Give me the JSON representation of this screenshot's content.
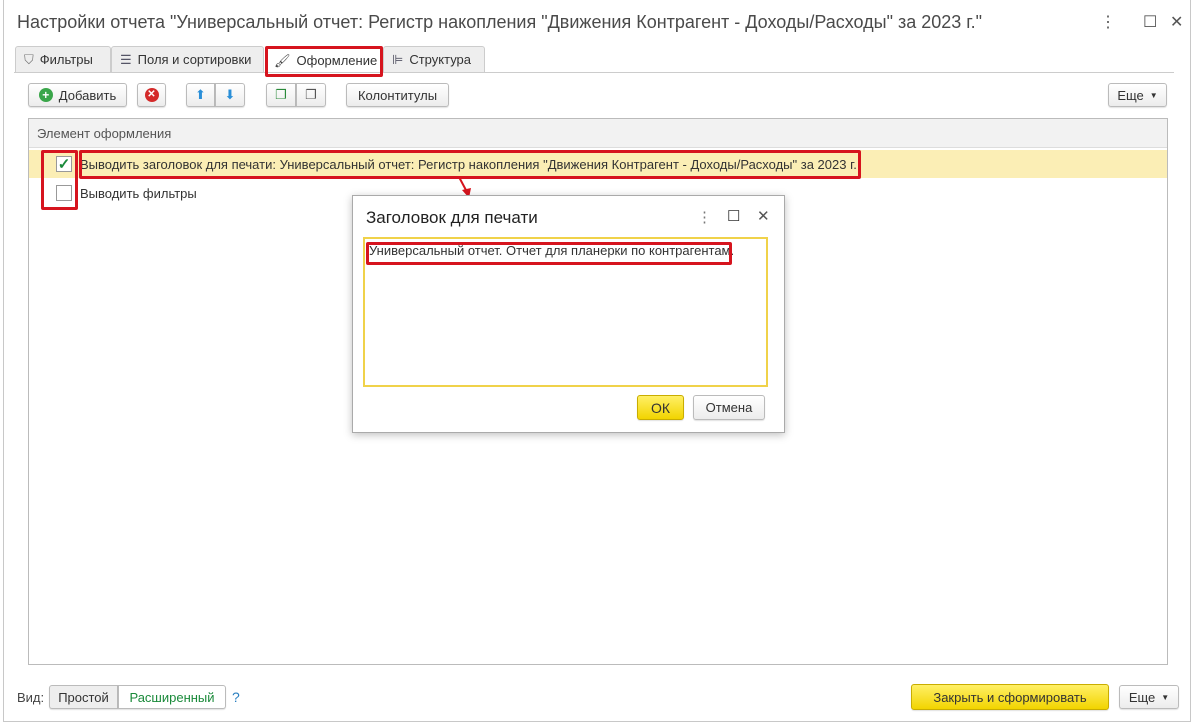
{
  "window": {
    "title": "Настройки отчета \"Универсальный отчет: Регистр накопления \"Движения Контрагент - Доходы/Расходы\" за 2023 г.\""
  },
  "tabs": [
    {
      "label": "Фильтры",
      "icon": "filter-icon"
    },
    {
      "label": "Поля и сортировки",
      "icon": "fields-sort-icon"
    },
    {
      "label": "Оформление",
      "icon": "brush-icon",
      "active": true
    },
    {
      "label": "Структура",
      "icon": "structure-icon"
    }
  ],
  "toolbar": {
    "add": "Добавить",
    "headers_footers": "Колонтитулы",
    "more": "Еще"
  },
  "grid": {
    "header": "Элемент оформления",
    "rows": [
      {
        "checked": true,
        "label": "Выводить заголовок для печати: Универсальный отчет: Регистр накопления \"Движения Контрагент - Доходы/Расходы\" за 2023 г."
      },
      {
        "checked": false,
        "label": "Выводить фильтры"
      }
    ]
  },
  "dialog": {
    "title": "Заголовок для печати",
    "text": "Универсальный отчет. Отчет для планерки по контрагентам.",
    "ok": "ОК",
    "cancel": "Отмена"
  },
  "footer": {
    "view_label": "Вид:",
    "simple": "Простой",
    "extended": "Расширенный",
    "help": "?",
    "close_and_generate": "Закрыть и сформировать",
    "more": "Еще"
  },
  "colors": {
    "accent_yellow": "#f2d400",
    "highlight_row": "#fbeeb5",
    "annotation_red": "#d6141e",
    "link_green": "#1a8a3a"
  }
}
